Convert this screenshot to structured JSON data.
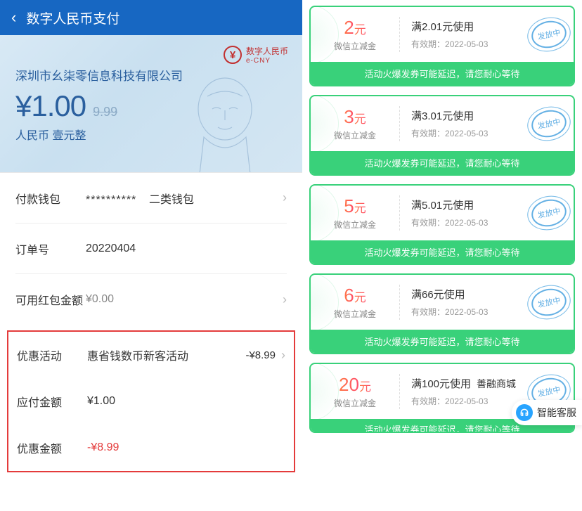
{
  "header": {
    "title": "数字人民币支付"
  },
  "banknote": {
    "ecny_cn": "数字人民币",
    "ecny_en": "e-CNY",
    "ecny_symbol": "¥",
    "merchant": "深圳市幺柒零信息科技有限公司",
    "amount": "¥1.00",
    "crossed": "9.99",
    "words": "人民币 壹元整"
  },
  "details": {
    "wallet_label": "付款钱包",
    "wallet_mask": "**********",
    "wallet_type": "二类钱包",
    "order_label": "订单号",
    "order_value": "20220404",
    "redpack_label": "可用红包金额",
    "redpack_value": "¥0.00"
  },
  "promo": {
    "activity_label": "优惠活动",
    "activity_name": "惠省钱数币新客活动",
    "activity_discount": "-¥8.99",
    "payable_label": "应付金额",
    "payable_value": "¥1.00",
    "discount_label": "优惠金额",
    "discount_value": "-¥8.99"
  },
  "coupons": [
    {
      "amount": "2",
      "unit": "元",
      "sub": "微信立减金",
      "condition": "满2.01元使用",
      "expiry_label": "有效期：",
      "expiry": "2022-05-03",
      "stamp": "发放中",
      "footer": "活动火爆发券可能延迟，请您耐心等待"
    },
    {
      "amount": "3",
      "unit": "元",
      "sub": "微信立减金",
      "condition": "满3.01元使用",
      "expiry_label": "有效期：",
      "expiry": "2022-05-03",
      "stamp": "发放中",
      "footer": "活动火爆发券可能延迟，请您耐心等待"
    },
    {
      "amount": "5",
      "unit": "元",
      "sub": "微信立减金",
      "condition": "满5.01元使用",
      "expiry_label": "有效期：",
      "expiry": "2022-05-03",
      "stamp": "发放中",
      "footer": "活动火爆发券可能延迟，请您耐心等待"
    },
    {
      "amount": "6",
      "unit": "元",
      "sub": "微信立减金",
      "condition": "满66元使用",
      "expiry_label": "有效期：",
      "expiry": "2022-05-03",
      "stamp": "发放中",
      "footer": "活动火爆发券可能延迟，请您耐心等待"
    },
    {
      "amount": "20",
      "unit": "元",
      "sub": "微信立减金",
      "condition": "满100元使用",
      "shop": "善融商城",
      "expiry_label": "有效期：",
      "expiry": "2022-05-03",
      "stamp": "发放中",
      "footer": "活动火爆发券可能延迟，请您耐心等待"
    }
  ],
  "support": {
    "label": "智能客服"
  }
}
